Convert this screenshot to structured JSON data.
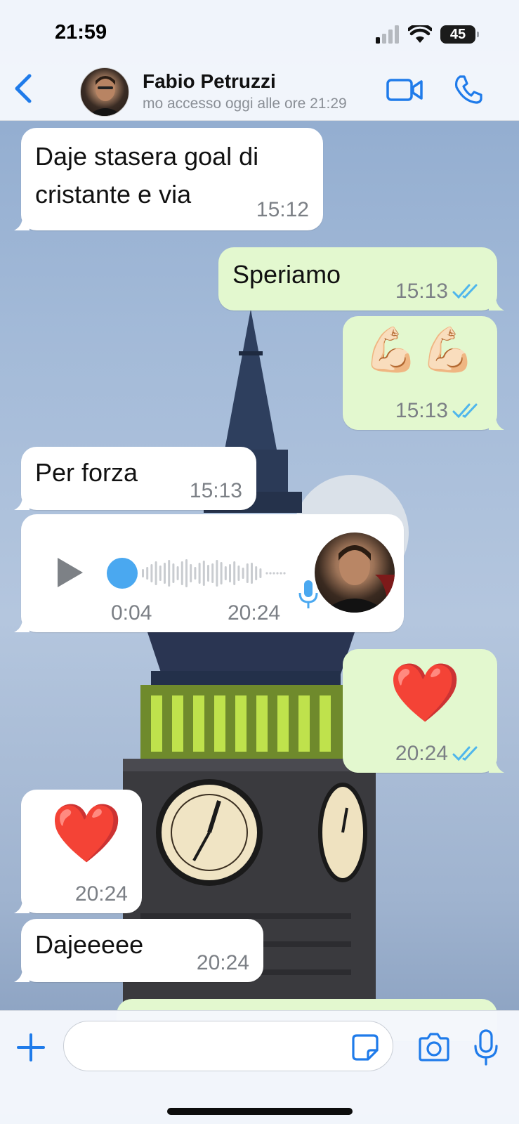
{
  "status_bar": {
    "time": "21:59",
    "battery": "45"
  },
  "header": {
    "contact_name": "Fabio Petruzzi",
    "contact_status": "mo accesso oggi alle ore 21:29"
  },
  "messages": [
    {
      "id": "m1",
      "direction": "incoming",
      "text": "Daje stasera goal di cristante e via",
      "time": "15:12"
    },
    {
      "id": "m2",
      "direction": "outgoing",
      "text": "Speriamo",
      "time": "15:13",
      "read": true
    },
    {
      "id": "m3",
      "direction": "outgoing",
      "emoji": "💪🏻💪🏻",
      "time": "15:13",
      "read": true
    },
    {
      "id": "m4",
      "direction": "incoming",
      "text": "Per forza",
      "time": "15:13"
    },
    {
      "id": "m5",
      "direction": "incoming",
      "type": "voice",
      "duration": "0:04",
      "time": "20:24",
      "progress": 0.0
    },
    {
      "id": "m6",
      "direction": "outgoing",
      "emoji": "❤️",
      "time": "20:24",
      "read": true
    },
    {
      "id": "m7",
      "direction": "incoming",
      "emoji": "❤️",
      "time": "20:24"
    },
    {
      "id": "m8",
      "direction": "incoming",
      "text": "Dajeeeee",
      "time": "20:24"
    }
  ],
  "composer": {
    "value": "",
    "placeholder": ""
  },
  "colors": {
    "accent": "#1f7bea",
    "incoming_bubble": "#ffffff",
    "outgoing_bubble": "#e3f8cf",
    "read_ticks": "#4fb6ec",
    "voice_dot": "#4aa8f0"
  },
  "icons": [
    "back-chevron",
    "video-camera",
    "phone",
    "double-check",
    "play",
    "microphone",
    "plus",
    "sticker",
    "camera"
  ]
}
